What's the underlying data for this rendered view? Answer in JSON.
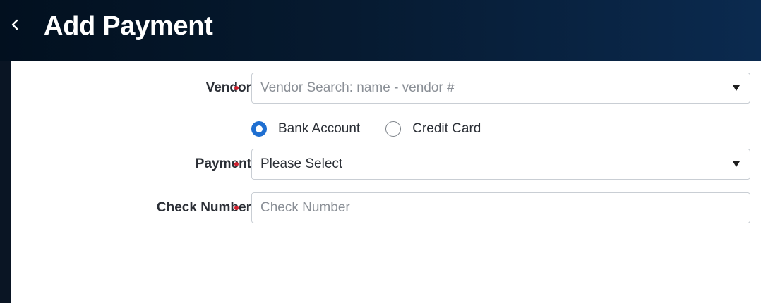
{
  "header": {
    "back_icon": "chevron-left-icon",
    "title": "Add Payment"
  },
  "form": {
    "vendor": {
      "label": "Vendor",
      "required": true,
      "placeholder": "Vendor Search: name - vendor #",
      "value": ""
    },
    "account_type": {
      "options": [
        {
          "label": "Bank Account",
          "selected": true
        },
        {
          "label": "Credit Card",
          "selected": false
        }
      ]
    },
    "payment": {
      "label": "Payment",
      "required": true,
      "selected": "Please Select"
    },
    "check_number": {
      "label": "Check Number",
      "required": true,
      "placeholder": "Check Number",
      "value": ""
    }
  },
  "colors": {
    "header_dark": "#02101f",
    "header_light": "#0b2a4f",
    "required_dot": "#d0202e",
    "radio_accent": "#1f6fd1"
  }
}
